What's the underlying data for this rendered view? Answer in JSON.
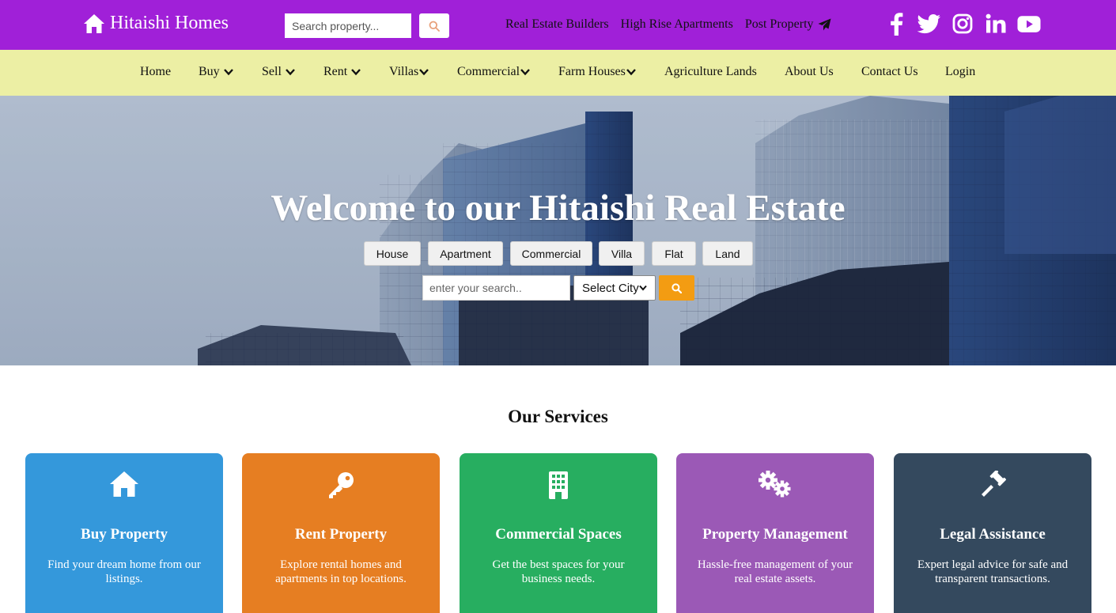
{
  "header": {
    "brand": "Hitaishi Homes",
    "search_placeholder": "Search property...",
    "links": [
      "Real Estate Builders",
      "High Rise Apartments",
      "Post Property"
    ],
    "social_icons": [
      "facebook-icon",
      "twitter-icon",
      "instagram-icon",
      "linkedin-icon",
      "youtube-icon"
    ],
    "bg_color": "#a020d8"
  },
  "nav": {
    "items": [
      "Home",
      "Buy",
      "Sell",
      "Rent",
      "Villas",
      "Commercial",
      "Farm Houses",
      "Agriculture Lands",
      "About Us",
      "Contact Us",
      "Login"
    ],
    "bg_color": "#ecefa4"
  },
  "hero": {
    "title": "Welcome to our Hitaishi Real Estate",
    "types": [
      "House",
      "Apartment",
      "Commercial",
      "Villa",
      "Flat",
      "Land"
    ],
    "search_placeholder": "enter your search..",
    "city_select": "Select City",
    "search_button_color": "#f39c12"
  },
  "services": {
    "title": "Our Services",
    "cards": [
      {
        "title": "Buy Property",
        "desc": "Find your dream home from our listings.",
        "icon": "house-icon",
        "color": "#3498db"
      },
      {
        "title": "Rent Property",
        "desc": "Explore rental homes and apartments in top locations.",
        "icon": "key-icon",
        "color": "#e67e22"
      },
      {
        "title": "Commercial Spaces",
        "desc": "Get the best spaces for your business needs.",
        "icon": "building-icon",
        "color": "#27ae60"
      },
      {
        "title": "Property Management",
        "desc": "Hassle-free management of your real estate assets.",
        "icon": "gears-icon",
        "color": "#9b59b6"
      },
      {
        "title": "Legal Assistance",
        "desc": "Expert legal advice for safe and transparent transactions.",
        "icon": "gavel-icon",
        "color": "#34495e"
      }
    ]
  }
}
